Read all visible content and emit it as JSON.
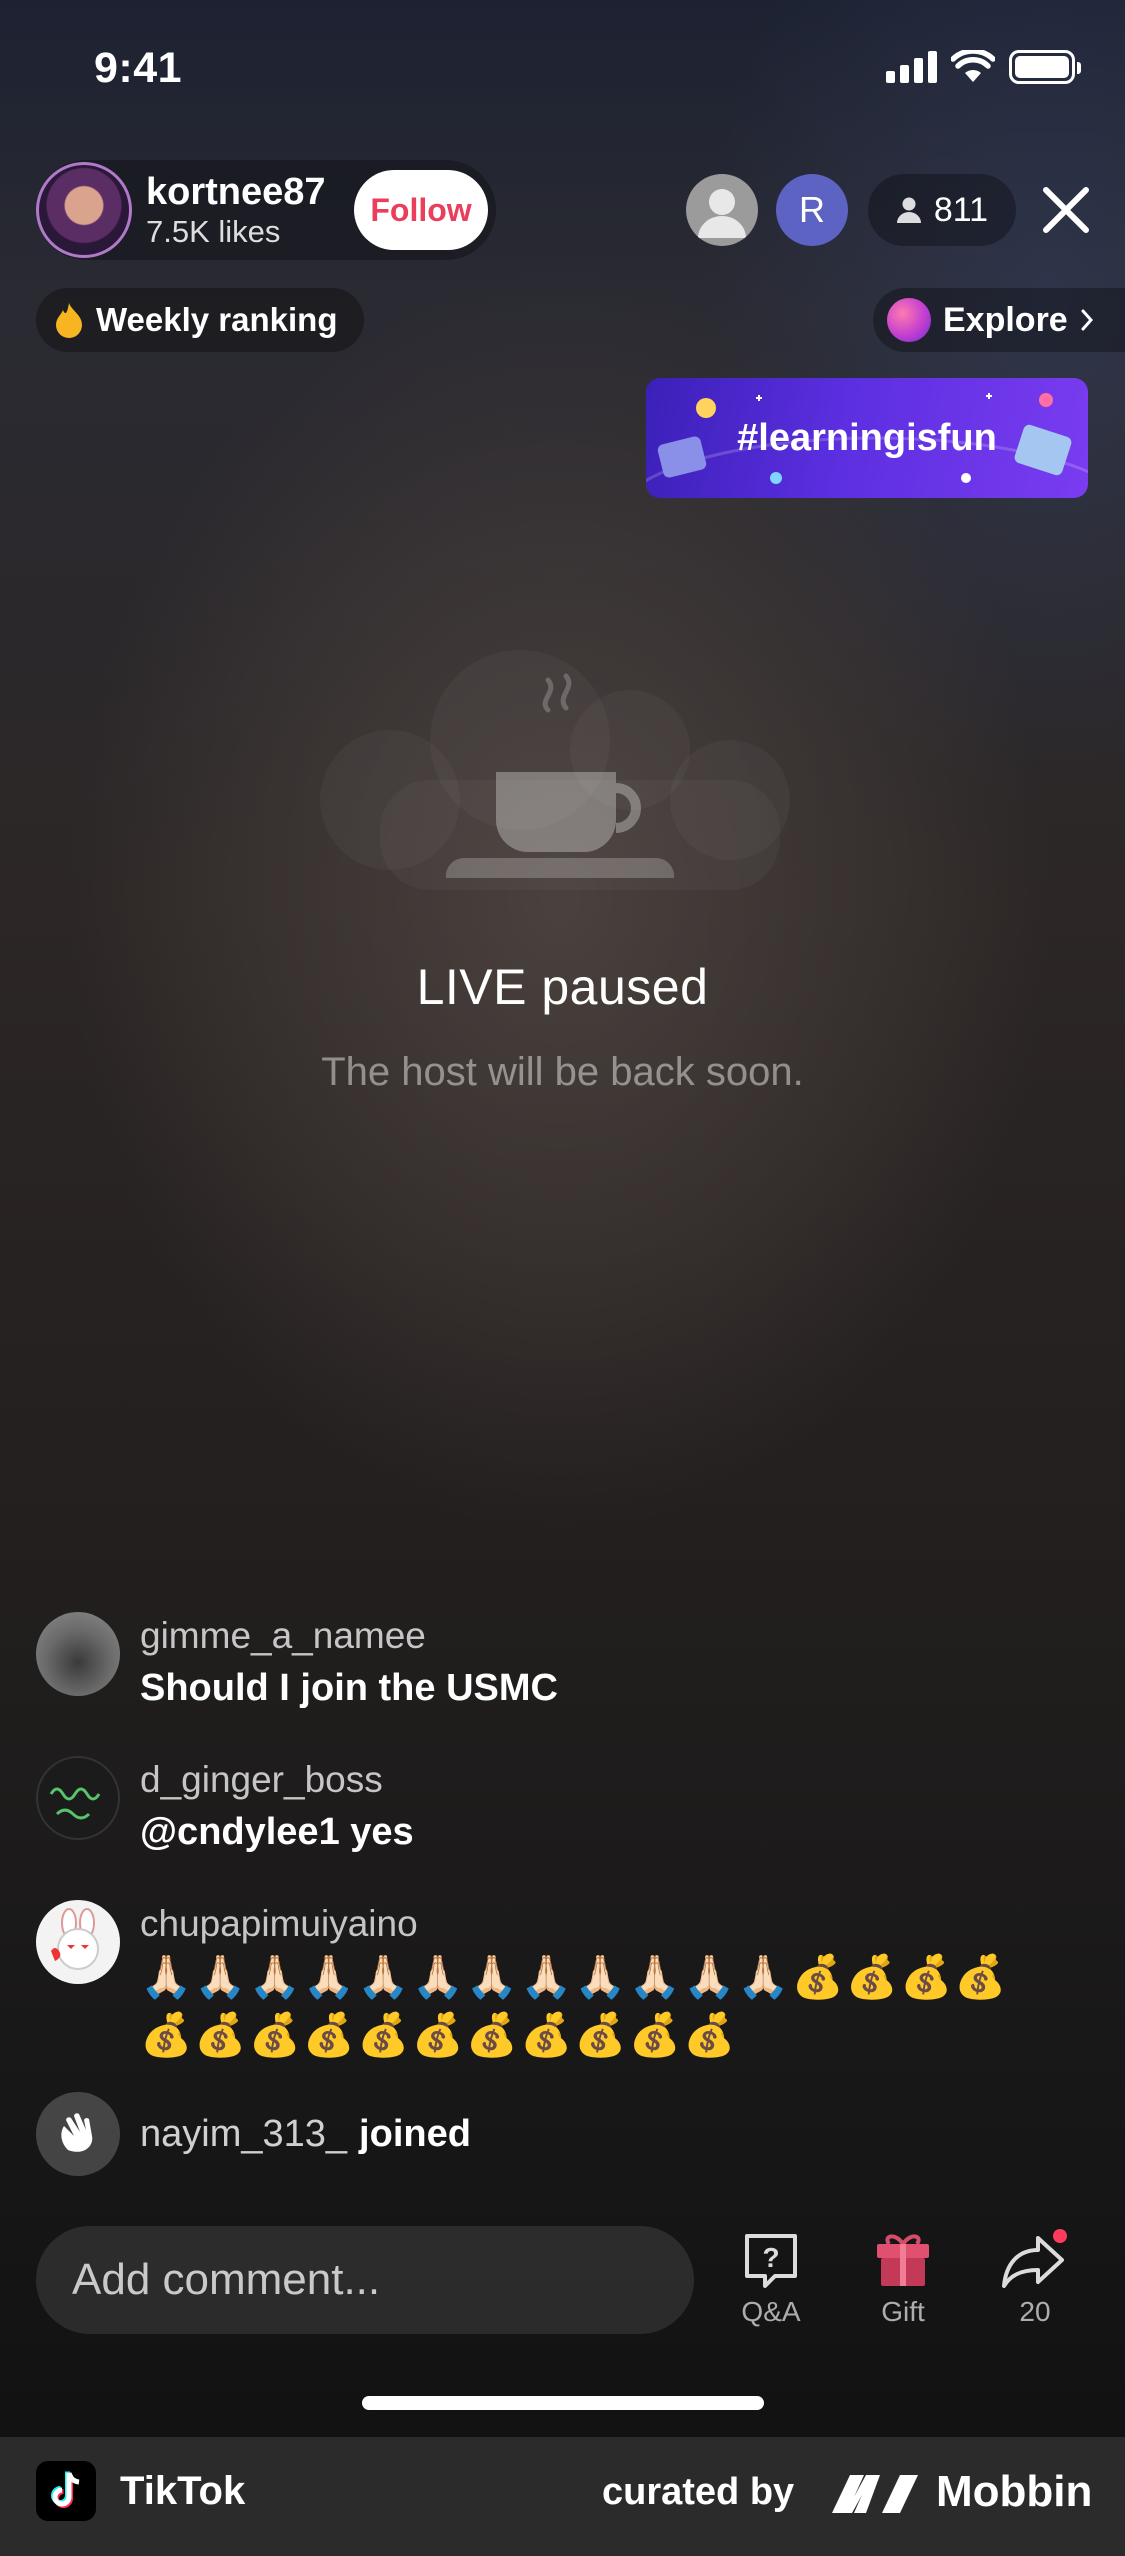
{
  "status_bar": {
    "time": "9:41"
  },
  "host": {
    "username": "kortnee87",
    "likes": "7.5K likes",
    "follow_label": "Follow"
  },
  "viewers": {
    "avatar_2_initial": "R",
    "count": "811"
  },
  "ranking": {
    "label": "Weekly ranking"
  },
  "explore": {
    "label": "Explore"
  },
  "banner": {
    "text": "#learningisfun"
  },
  "paused": {
    "title": "LIVE paused",
    "subtitle": "The host will be back soon."
  },
  "comments": [
    {
      "user": "gimme_a_namee",
      "text": "Should I join the USMC"
    },
    {
      "user": "d_ginger_boss",
      "text": "@cndylee1 yes"
    },
    {
      "user": "chupapimuiyaino",
      "text_line1": "🙏🏻🙏🏻🙏🏻🙏🏻🙏🏻🙏🏻🙏🏻🙏🏻🙏🏻🙏🏻🙏🏻🙏🏻💰💰💰💰",
      "text_line2": "💰💰💰💰💰💰💰💰💰💰💰"
    },
    {
      "user": "nayim_313_",
      "text": "joined"
    }
  ],
  "comment_input": {
    "placeholder": "Add comment..."
  },
  "actions": {
    "qa_label": "Q&A",
    "gift_label": "Gift",
    "share_count": "20"
  },
  "footer": {
    "app_name": "TikTok",
    "curated_by": "curated by",
    "brand": "Mobbin"
  },
  "colors": {
    "follow_text": "#ea3f5c",
    "viewer_avatar_2": "#5d63c2",
    "banner": "#5c2fe0"
  }
}
